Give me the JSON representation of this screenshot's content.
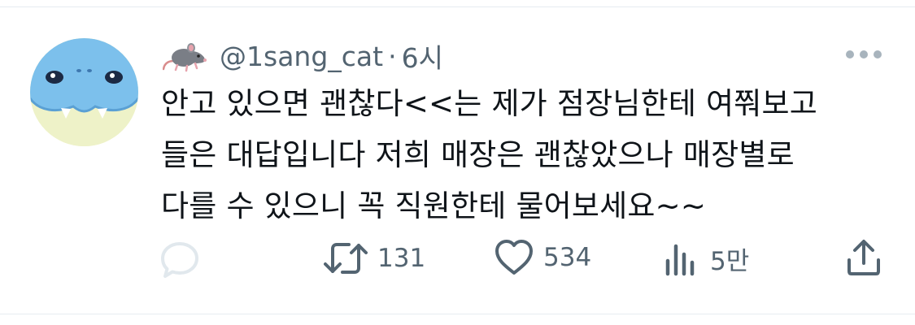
{
  "tweet": {
    "user_emoji": "🐀",
    "handle": "@1sang_cat",
    "separator": "·",
    "time": "6시",
    "text_lines": [
      "안고 있으면 괜찮다<<는 제가 점장님한테 여쭤보고",
      "들은 대답입니다 저희 매장은 괜찮았으나 매장별로",
      "다를 수 있으니 꼭 직원한테 물어보세요~~"
    ]
  },
  "actions": {
    "reply": {
      "icon": "reply-icon",
      "count": ""
    },
    "retweet": {
      "icon": "retweet-icon",
      "count": "131"
    },
    "like": {
      "icon": "heart-icon",
      "count": "534"
    },
    "views": {
      "icon": "views-icon",
      "count": "5만"
    },
    "share": {
      "icon": "share-icon"
    }
  },
  "colors": {
    "text": "#0f1419",
    "secondary": "#536471",
    "reply_icon": "#e1e8ed",
    "divider": "#e6ecf0"
  }
}
